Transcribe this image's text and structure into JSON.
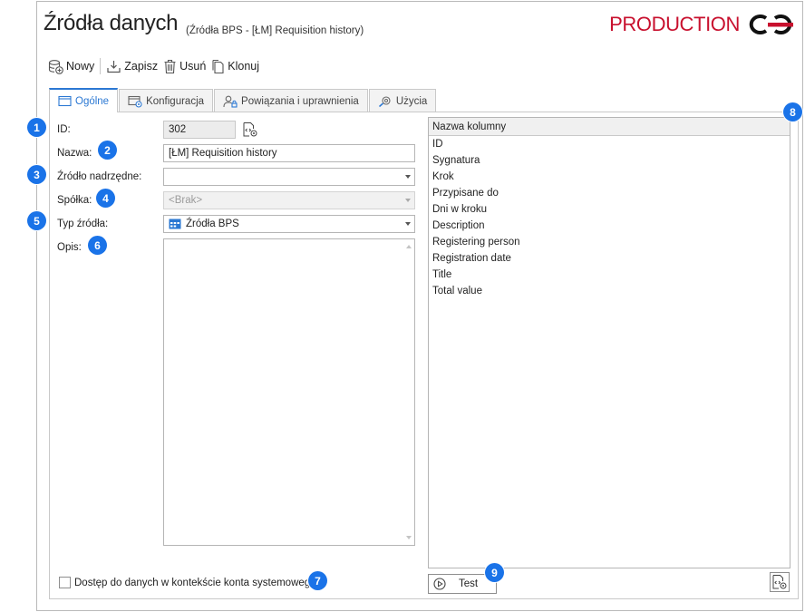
{
  "header": {
    "title": "Źródła danych",
    "subtitle": "(Źródła BPS - [ŁM] Requisition history)",
    "brand": "PRODUCTION",
    "brand_color": "#c8102e"
  },
  "toolbar": {
    "new_label": "Nowy",
    "save_label": "Zapisz",
    "delete_label": "Usuń",
    "clone_label": "Klonuj"
  },
  "tabs": [
    {
      "label": "Ogólne",
      "active": true
    },
    {
      "label": "Konfiguracja",
      "active": false
    },
    {
      "label": "Powiązania i uprawnienia",
      "active": false
    },
    {
      "label": "Użycia",
      "active": false
    }
  ],
  "form": {
    "id_label": "ID:",
    "id_value": "302",
    "name_label": "Nazwa:",
    "name_value": "[ŁM] Requisition history",
    "parent_label": "Źródło nadrzędne:",
    "parent_value": "",
    "company_label": "Spółka:",
    "company_value": "<Brak>",
    "type_label": "Typ źródła:",
    "type_value": "Źródła BPS",
    "desc_label": "Opis:",
    "desc_value": ""
  },
  "columns": {
    "header": "Nazwa kolumny",
    "items": [
      "ID",
      "Sygnatura",
      "Krok",
      "Przypisane do",
      "Dni w kroku",
      "Description",
      "Registering person",
      "Registration date",
      "Title",
      "Total value"
    ]
  },
  "footer": {
    "system_account_label": "Dostęp do danych w kontekście konta systemowego",
    "test_label": "Test"
  },
  "badges": [
    "1",
    "2",
    "3",
    "4",
    "5",
    "6",
    "7",
    "8",
    "9"
  ],
  "accent_color": "#2b78d3",
  "badge_color": "#1a73e8"
}
